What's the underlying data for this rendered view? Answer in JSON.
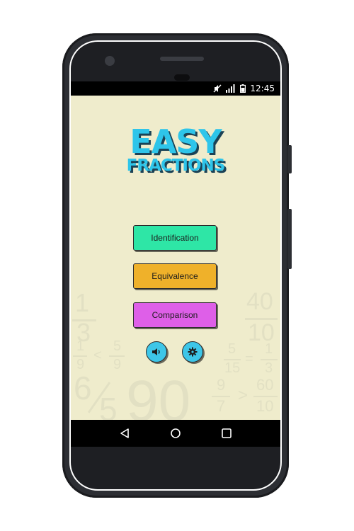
{
  "status_bar": {
    "time": "12:45"
  },
  "title": {
    "line1": "EASY",
    "line2": "FRACTIONS"
  },
  "menu": {
    "identification": {
      "label": "Identification",
      "color": "#2ee6a6"
    },
    "equivalence": {
      "label": "Equivalence",
      "color": "#efb12a"
    },
    "comparison": {
      "label": "Comparison",
      "color": "#de5fe8"
    }
  },
  "controls": {
    "sound_icon": "speaker-icon",
    "settings_icon": "gear-icon"
  },
  "background_decor": {
    "left_top_fraction": {
      "numerator": "1",
      "denominator": "3"
    },
    "left_compare": {
      "a_num": "1",
      "a_den": "9",
      "symbol": "<",
      "b_num": "5",
      "b_den": "9"
    },
    "left_bottom_fraction": {
      "numerator": "6",
      "denominator": "5"
    },
    "center_number": "90",
    "right_top_fraction": {
      "numerator": "40",
      "denominator": "10"
    },
    "right_equal": {
      "a_num": "5",
      "a_den": "15",
      "symbol": "=",
      "b_num": "1",
      "b_den": "3"
    },
    "right_compare": {
      "a_num": "9",
      "a_den": "7",
      "symbol": ">",
      "b_num": "60",
      "b_den": "10"
    }
  },
  "nav_bar": {
    "back_icon": "back-icon",
    "home_icon": "home-icon",
    "recents_icon": "recents-icon"
  }
}
